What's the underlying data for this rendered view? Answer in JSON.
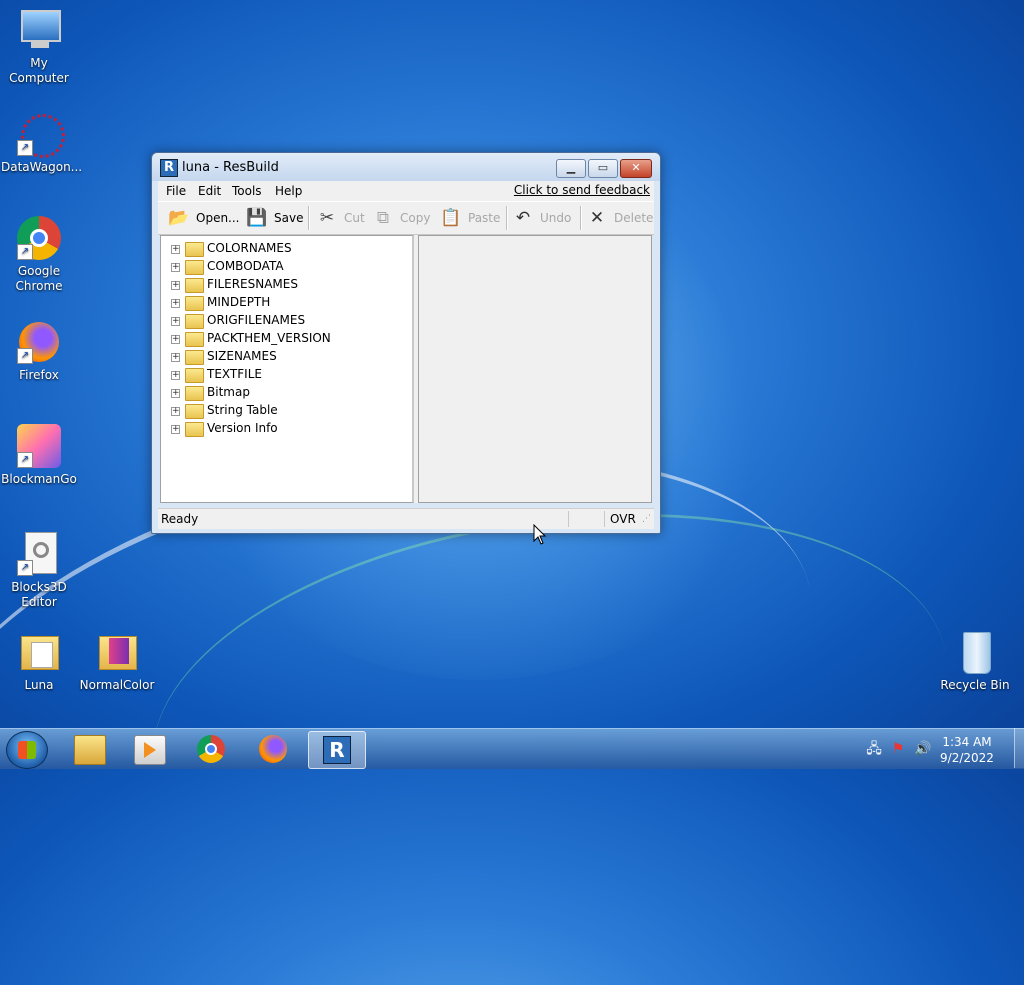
{
  "desktop": {
    "icons": [
      {
        "label": "My Computer"
      },
      {
        "label": "DataWagon..."
      },
      {
        "label": "Google Chrome"
      },
      {
        "label": "Firefox"
      },
      {
        "label": "BlockmanGo"
      },
      {
        "label": "Blocks3D Editor"
      },
      {
        "label": "Luna"
      },
      {
        "label": "NormalColor"
      },
      {
        "label": "Recycle Bin"
      }
    ]
  },
  "window": {
    "title": "luna - ResBuild",
    "menu": [
      "File",
      "Edit",
      "Tools",
      "Help"
    ],
    "feedback_link": "Click to send feedback",
    "toolbar": {
      "open": "Open...",
      "save": "Save",
      "cut": "Cut",
      "copy": "Copy",
      "paste": "Paste",
      "undo": "Undo",
      "delete": "Delete"
    },
    "tree": [
      "COLORNAMES",
      "COMBODATA",
      "FILERESNAMES",
      "MINDEPTH",
      "ORIGFILENAMES",
      "PACKTHEM_VERSION",
      "SIZENAMES",
      "TEXTFILE",
      "Bitmap",
      "String Table",
      "Version Info"
    ],
    "status": {
      "text": "Ready",
      "mode": "OVR"
    }
  },
  "taskbar": {
    "clock_time": "1:34 AM",
    "clock_date": "9/2/2022"
  },
  "colors": {
    "desktop_blue": "#0d56b8",
    "title_bar": "#c4d7ee",
    "close_red": "#c4432a"
  }
}
